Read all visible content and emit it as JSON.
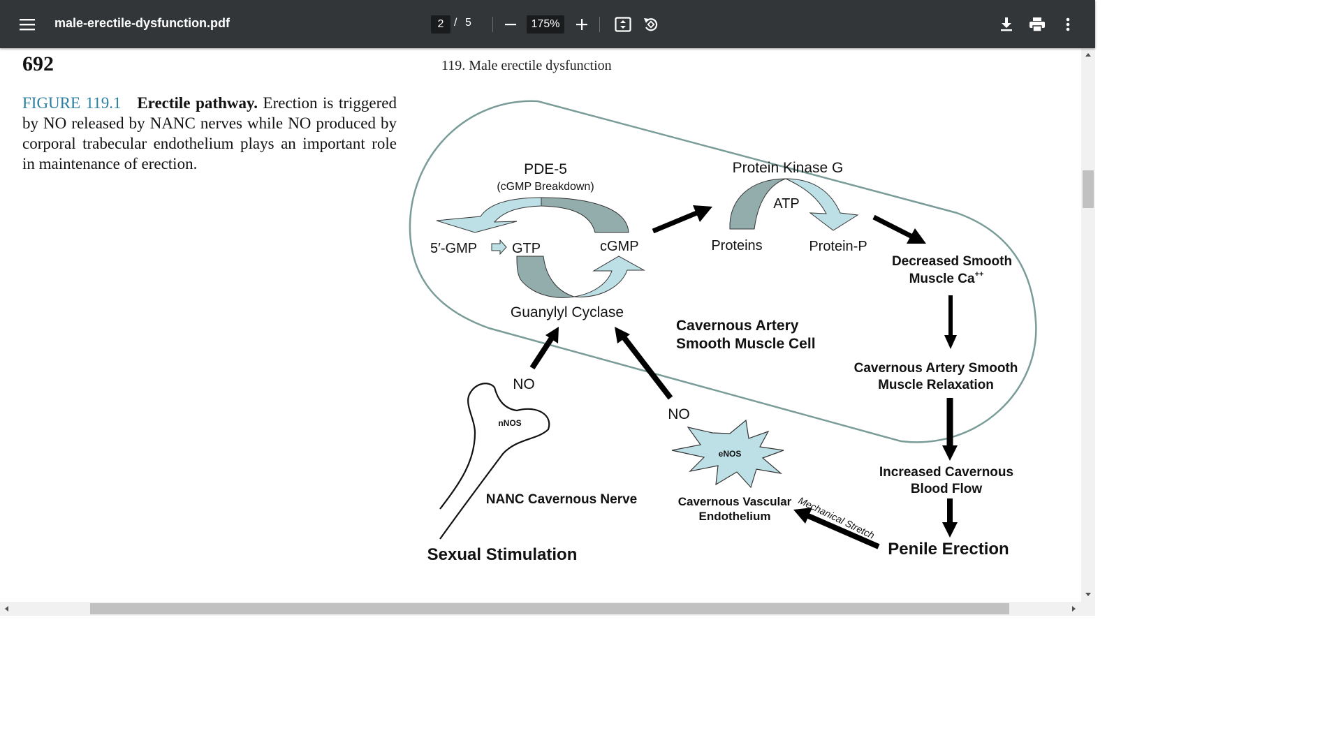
{
  "toolbar": {
    "file_name": "male-erectile-dysfunction.pdf",
    "current_page": "2",
    "page_separator": "/",
    "total_pages": "5",
    "zoom": "175%",
    "icons": [
      "menu-icon",
      "zoom-out-icon",
      "zoom-in-icon",
      "fit-page-icon",
      "rotate-icon",
      "download-icon",
      "print-icon",
      "more-options-icon"
    ]
  },
  "page": {
    "page_number": "692",
    "running_head": "119.  Male erectile dysfunction",
    "caption": {
      "label": "FIGURE 119.1",
      "title": "Erectile pathway.",
      "text": "Erection is triggered by NO released by NANC nerves while NO produced by corporal trabecular endothelium plays an important role in maintenance of erection."
    }
  },
  "diagram": {
    "pde5": "PDE-5",
    "pde5_sub": "(cGMP Breakdown)",
    "gmp": "5′-GMP",
    "gtp": "GTP",
    "cgmp": "cGMP",
    "guanylyl": "Guanylyl Cyclase",
    "pkg": "Protein Kinase G",
    "atp": "ATP",
    "proteins": "Proteins",
    "protein_p": "Protein-P",
    "dec_ca_1": "Decreased Smooth",
    "dec_ca_2": "Muscle Ca",
    "dec_ca_sup": "++",
    "cell_1": "Cavernous Artery",
    "cell_2": "Smooth Muscle Cell",
    "relax_1": "Cavernous Artery Smooth",
    "relax_2": "Muscle Relaxation",
    "blood_1": "Increased Cavernous",
    "blood_2": "Blood Flow",
    "erection": "Penile Erection",
    "no_left": "NO",
    "no_right": "NO",
    "nnos": "nNOS",
    "enos": "eNOS",
    "nerve": "NANC Cavernous Nerve",
    "endo_1": "Cavernous Vascular",
    "endo_2": "Endothelium",
    "stretch": "Mechanical Stretch",
    "stimulation": "Sexual Stimulation"
  },
  "colors": {
    "toolbar": "#323639",
    "figure_label": "#2a7fa0",
    "arrow_light": "#bde0e6",
    "arrow_dark": "#93adad",
    "cell_outline": "#7a9c98"
  }
}
